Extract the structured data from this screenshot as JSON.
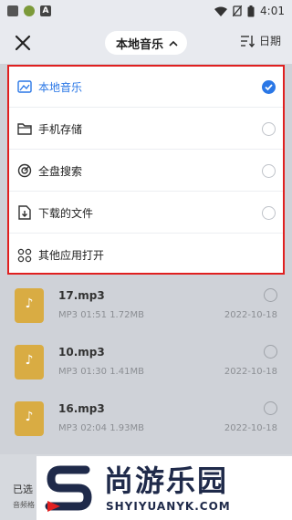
{
  "status_bar": {
    "time": "4:01",
    "left_icons": [
      "app-icon",
      "android-icon",
      "a-icon"
    ],
    "right_icons": [
      "wifi-icon",
      "no-sim-icon",
      "battery-icon"
    ]
  },
  "header": {
    "title": "本地音乐",
    "sort_label": "日期"
  },
  "menu": {
    "options": [
      {
        "label": "本地音乐",
        "icon": "local-music-icon",
        "selected": true
      },
      {
        "label": "手机存储",
        "icon": "folder-icon",
        "selected": false
      },
      {
        "label": "全盘搜索",
        "icon": "disk-scan-icon",
        "selected": false
      },
      {
        "label": "下载的文件",
        "icon": "download-file-icon",
        "selected": false
      },
      {
        "label": "其他应用打开",
        "icon": "apps-icon",
        "selected": false
      }
    ]
  },
  "files": [
    {
      "name": "17.mp3",
      "meta": "MP3  01:51  1.72MB",
      "date": "2022-10-18"
    },
    {
      "name": "10.mp3",
      "meta": "MP3  01:30  1.41MB",
      "date": "2022-10-18"
    },
    {
      "name": "16.mp3",
      "meta": "MP3  02:04  1.93MB",
      "date": "2022-10-18"
    }
  ],
  "bottom": {
    "selected_label": "已选",
    "sub_label": "音频格"
  },
  "watermark": {
    "cn": "尚游乐园",
    "en": "SHYIYUANYK.COM"
  },
  "colors": {
    "accent": "#2a77e6",
    "highlight_border": "#e02020",
    "file_icon": "#d9ac43"
  }
}
